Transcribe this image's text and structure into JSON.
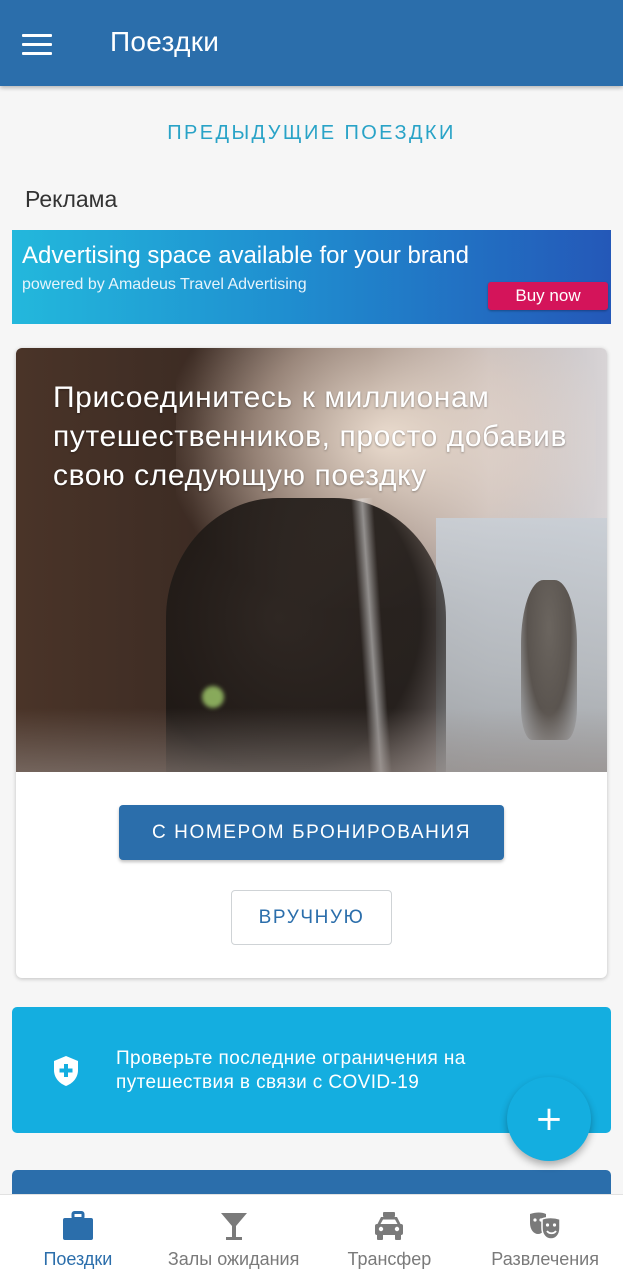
{
  "topbar": {
    "title": "Поездки",
    "menu_icon": "hamburger-menu-icon"
  },
  "previous_trips_link": "ПРЕДЫДУЩИЕ ПОЕЗДКИ",
  "ad": {
    "label": "Реклама",
    "banner_title": "Advertising space available for your brand",
    "banner_subtitle": "powered by Amadeus Travel Advertising",
    "banner_button": "Buy now"
  },
  "join_card": {
    "headline": "Присоединитесь к миллионам путешественников, просто добавив свою следующую поездку",
    "primary_button": "С НОМЕРОМ БРОНИРОВАНИЯ",
    "secondary_button": "ВРУЧНУЮ"
  },
  "covid_banner": {
    "icon": "shield-plus-icon",
    "text": "Проверьте последние ограничения на путешествия в связи с COVID-19"
  },
  "fab": {
    "icon": "plus-icon",
    "symbol": "+"
  },
  "bottom_nav": {
    "items": [
      {
        "label": "Поездки",
        "icon": "briefcase-icon",
        "active": true
      },
      {
        "label": "Залы ожидания",
        "icon": "cocktail-icon",
        "active": false
      },
      {
        "label": "Трансфер",
        "icon": "taxi-icon",
        "active": false
      },
      {
        "label": "Развлечения",
        "icon": "theater-masks-icon",
        "active": false
      }
    ]
  },
  "colors": {
    "primary": "#2b6eab",
    "accent": "#14aee0",
    "link": "#29a3c7",
    "ad_button": "#d4145a"
  }
}
